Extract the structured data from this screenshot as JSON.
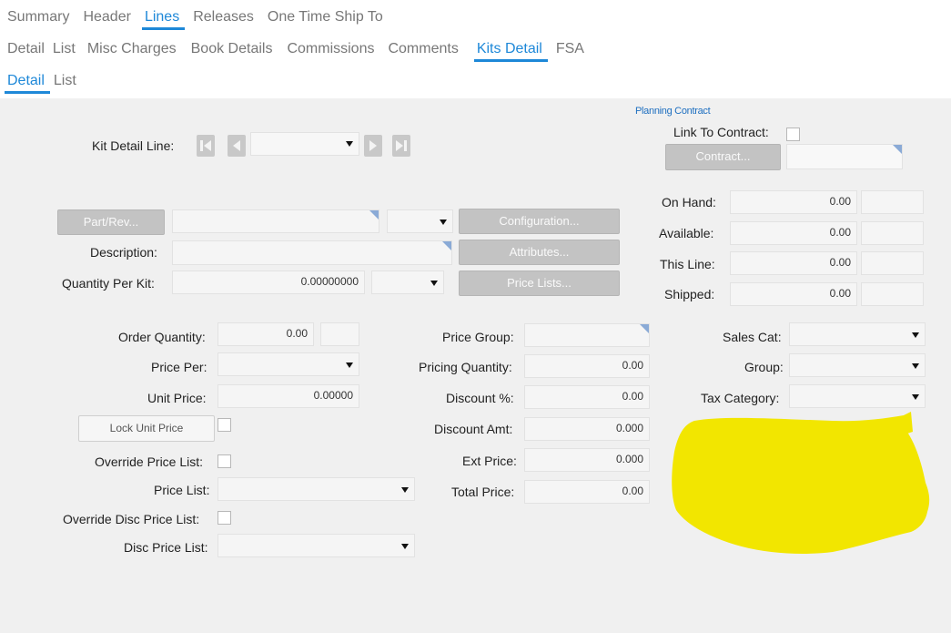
{
  "tabs_level1": [
    "Summary",
    "Header",
    "Lines",
    "Releases",
    "One Time Ship To"
  ],
  "tabs_level1_active": "Lines",
  "tabs_level2": [
    "Detail",
    "List",
    "Misc Charges",
    "Book Details",
    "Commissions",
    "Comments",
    "Kits Detail",
    "FSA"
  ],
  "tabs_level2_active": "Kits Detail",
  "tabs_level3": [
    "Detail",
    "List"
  ],
  "tabs_level3_active": "Detail",
  "kit_detail": {
    "line_label": "Kit Detail Line:",
    "line_value": ""
  },
  "planning": {
    "heading": "Planning Contract",
    "link_label": "Link To Contract:",
    "link_checked": false,
    "contract_button": "Contract...",
    "contract_value": ""
  },
  "part": {
    "part_button": "Part/Rev...",
    "part_value": "",
    "rev_value": "",
    "configuration_button": "Configuration...",
    "description_label": "Description:",
    "description_value": "",
    "attributes_button": "Attributes...",
    "qty_per_kit_label": "Quantity Per Kit:",
    "qty_per_kit_value": "0.00000000",
    "qty_per_kit_uom": "",
    "price_lists_button": "Price Lists..."
  },
  "inventory": {
    "on_hand_label": "On Hand:",
    "on_hand_value": "0.00",
    "available_label": "Available:",
    "available_value": "0.00",
    "this_line_label": "This Line:",
    "this_line_value": "0.00",
    "shipped_label": "Shipped:",
    "shipped_value": "0.00"
  },
  "pricing_left": {
    "order_qty_label": "Order Quantity:",
    "order_qty_value": "0.00",
    "order_qty_uom": "",
    "price_per_label": "Price Per:",
    "price_per_value": "",
    "unit_price_label": "Unit Price:",
    "unit_price_value": "0.00000",
    "lock_unit_price_button": "Lock Unit Price",
    "lock_checked": false,
    "override_price_list_label": "Override Price List:",
    "override_price_list_checked": false,
    "price_list_label": "Price List:",
    "price_list_value": "",
    "override_disc_label": "Override Disc Price List:",
    "override_disc_checked": false,
    "disc_price_list_label": "Disc Price List:",
    "disc_price_list_value": ""
  },
  "pricing_mid": {
    "price_group_label": "Price Group:",
    "price_group_value": "",
    "pricing_qty_label": "Pricing Quantity:",
    "pricing_qty_value": "0.00",
    "discount_pct_label": "Discount %:",
    "discount_pct_value": "0.00",
    "discount_amt_label": "Discount Amt:",
    "discount_amt_value": "0.000",
    "ext_price_label": "Ext Price:",
    "ext_price_value": "0.000",
    "total_price_label": "Total Price:",
    "total_price_value": "0.00"
  },
  "pricing_right": {
    "sales_cat_label": "Sales Cat:",
    "sales_cat_value": "",
    "group_label": "Group:",
    "group_value": "",
    "tax_category_label": "Tax Category:",
    "tax_category_value": ""
  },
  "colors": {
    "accent": "#1e88d8",
    "panel_bg": "#f0f0f0",
    "highlight": "#f2e600"
  }
}
